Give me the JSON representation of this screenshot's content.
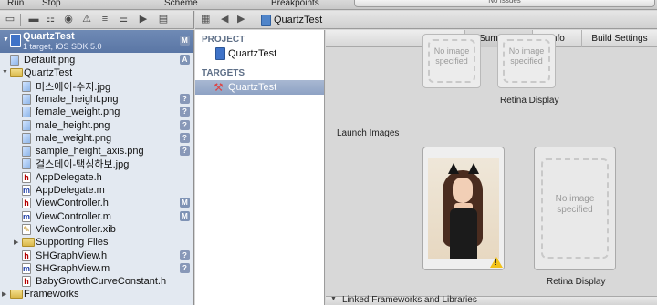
{
  "menubar": {
    "run": "Run",
    "stop": "Stop",
    "scheme": "Scheme",
    "breakpoints": "Breakpoints",
    "status": "No Issues"
  },
  "navigator_toolbar": {
    "icons": [
      "folder-icon",
      "hierarchy-icon",
      "search-icon",
      "warning-icon",
      "breakpoint-icon",
      "log-icon"
    ]
  },
  "jumpbar": {
    "file": "QuartzTest"
  },
  "navigator": {
    "project": {
      "name": "QuartzTest",
      "subtitle": "1 target, iOS SDK 5.0",
      "badge": "M"
    },
    "items": [
      {
        "label": "Default.png",
        "type": "img",
        "indent": 0,
        "badge": "A"
      },
      {
        "label": "QuartzTest",
        "type": "folder",
        "indent": 0,
        "disclosure": "open"
      },
      {
        "label": "미스에이-수지.jpg",
        "type": "img",
        "indent": 1
      },
      {
        "label": "female_height.png",
        "type": "img",
        "indent": 1,
        "badge": "?"
      },
      {
        "label": "female_weight.png",
        "type": "img",
        "indent": 1,
        "badge": "?"
      },
      {
        "label": "male_height.png",
        "type": "img",
        "indent": 1,
        "badge": "?"
      },
      {
        "label": "male_weight.png",
        "type": "img",
        "indent": 1,
        "badge": "?"
      },
      {
        "label": "sample_height_axis.png",
        "type": "img",
        "indent": 1,
        "badge": "?"
      },
      {
        "label": "걸스데이-택심하보.jpg",
        "type": "img",
        "indent": 1
      },
      {
        "label": "AppDelegate.h",
        "type": "h",
        "indent": 1
      },
      {
        "label": "AppDelegate.m",
        "type": "m",
        "indent": 1
      },
      {
        "label": "ViewController.h",
        "type": "h",
        "indent": 1,
        "badge": "M"
      },
      {
        "label": "ViewController.m",
        "type": "m",
        "indent": 1,
        "badge": "M"
      },
      {
        "label": "ViewController.xib",
        "type": "xib",
        "indent": 1
      },
      {
        "label": "Supporting Files",
        "type": "folder",
        "indent": 1,
        "disclosure": "closed"
      },
      {
        "label": "SHGraphView.h",
        "type": "h",
        "indent": 1,
        "badge": "?"
      },
      {
        "label": "SHGraphView.m",
        "type": "m",
        "indent": 1,
        "badge": "?"
      },
      {
        "label": "BabyGrowthCurveConstant.h",
        "type": "h",
        "indent": 1
      },
      {
        "label": "Frameworks",
        "type": "folder",
        "indent": 0,
        "disclosure": "closed"
      }
    ]
  },
  "project_column": {
    "project_header": "PROJECT",
    "project_item": "QuartzTest",
    "targets_header": "TARGETS",
    "target_item": "QuartzTest"
  },
  "editor": {
    "tabs": [
      "Summary",
      "Info",
      "Build Settings"
    ],
    "selected_tab": "Summary",
    "top_wells": [
      {
        "text": "No image specified"
      },
      {
        "text": "No image specified"
      }
    ],
    "retina_caption_top": "Retina Display",
    "launch_images_title": "Launch Images",
    "launch_placeholder": "No image specified",
    "retina_caption_bottom": "Retina Display",
    "linked_section": "Linked Frameworks and Libraries"
  },
  "colors": {
    "selection": "#5a76a5",
    "navigator_bg": "#e3e9f1",
    "editor_bg": "#d8d8d8"
  }
}
